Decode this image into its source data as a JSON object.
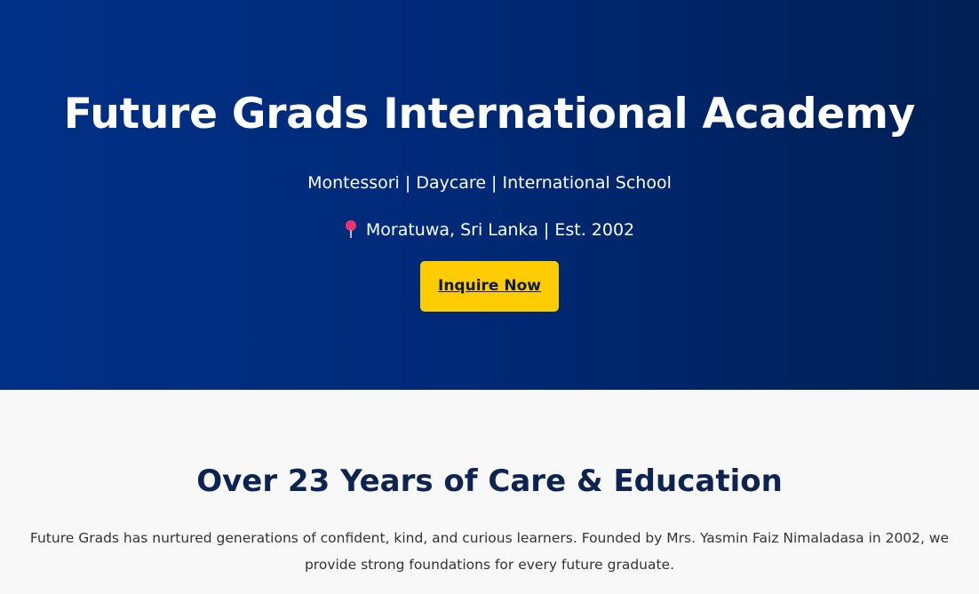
{
  "hero": {
    "title": "Future Grads International Academy",
    "tagline": "Montessori | Daycare | International School",
    "location_icon": "round-pushpin-icon",
    "location": "Moratuwa, Sri Lanka | Est. 2002",
    "cta_label": "Inquire Now"
  },
  "about": {
    "heading": "Over 23 Years of Care & Education",
    "text": "Future Grads has nurtured generations of confident, kind, and curious learners. Founded by Mrs. Yasmin Faiz Nimaladasa in 2002, we provide strong foundations for every future graduate."
  },
  "colors": {
    "hero_gradient_start": "#003087",
    "hero_gradient_end": "#001f54",
    "cta_background": "#ffcc00",
    "heading_navy": "#0d2350",
    "section_background": "#f8f8f9"
  }
}
